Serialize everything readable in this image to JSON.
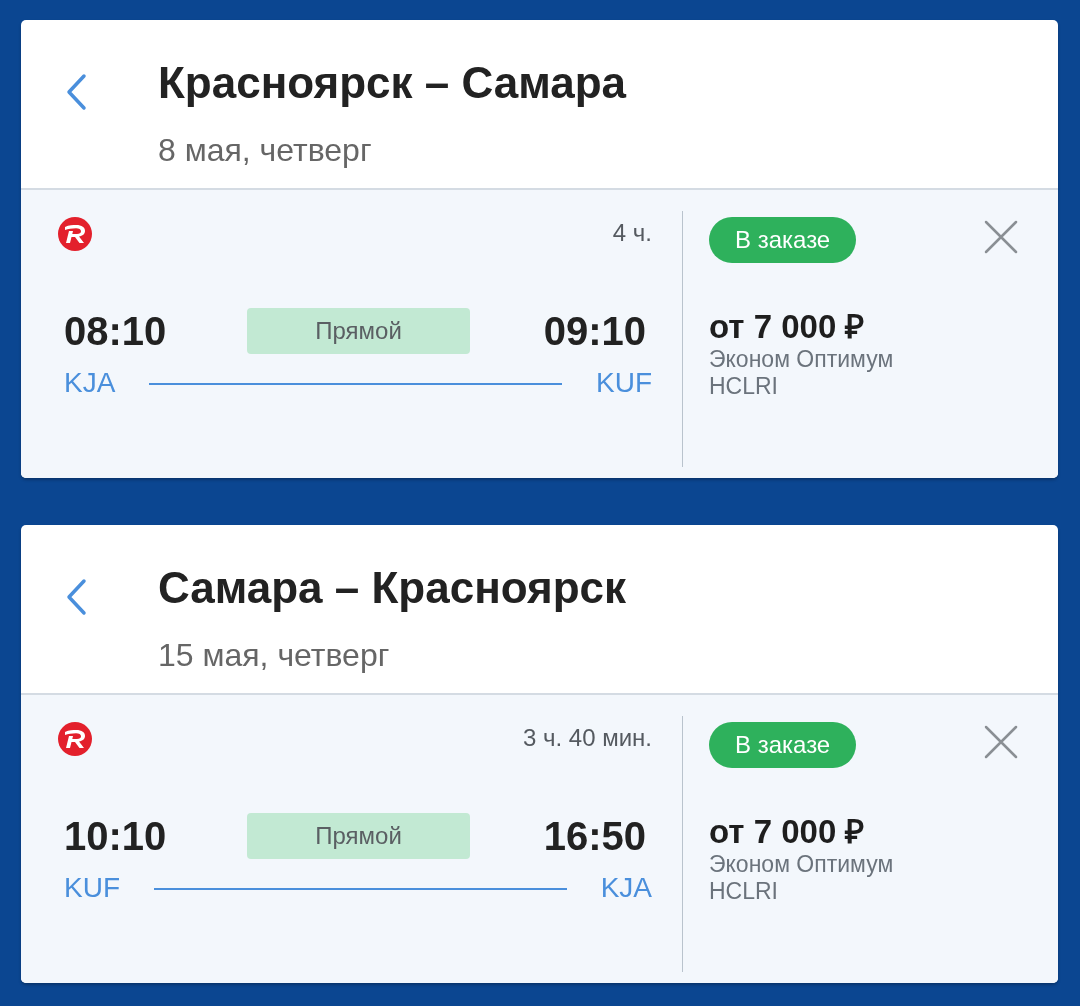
{
  "trips": [
    {
      "route": "Красноярск – Самара",
      "date": "8 мая, четверг",
      "flight": {
        "duration": "4 ч.",
        "departure_time": "08:10",
        "stops": "Прямой",
        "arrival_time": "09:10",
        "origin": "KJA",
        "destination": "KUF",
        "status": "В заказе",
        "price": "от 7 000 ₽",
        "fare": "Эконом Оптимум",
        "fare_code": "HCLRI"
      }
    },
    {
      "route": "Самара – Красноярск",
      "date": "15 мая, четверг",
      "flight": {
        "duration": "3 ч. 40 мин.",
        "departure_time": "10:10",
        "stops": "Прямой",
        "arrival_time": "16:50",
        "origin": "KUF",
        "destination": "KJA",
        "status": "В заказе",
        "price": "от 7 000 ₽",
        "fare": "Эконом Оптимум",
        "fare_code": "HCLRI"
      }
    }
  ]
}
